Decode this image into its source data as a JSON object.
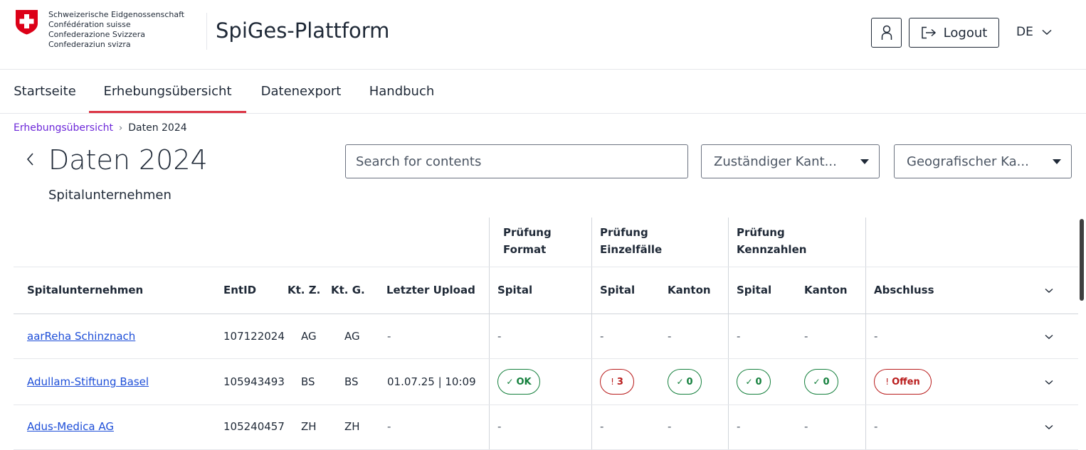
{
  "header": {
    "confederation": [
      "Schweizerische Eidgenossenschaft",
      "Confédération suisse",
      "Confederazione Svizzera",
      "Confederaziun svizra"
    ],
    "app_title": "SpiGes-Plattform",
    "logout_label": "Logout",
    "language": "DE"
  },
  "nav": {
    "items": [
      {
        "label": "Startseite"
      },
      {
        "label": "Erhebungsübersicht",
        "active": true
      },
      {
        "label": "Datenexport"
      },
      {
        "label": "Handbuch"
      }
    ]
  },
  "breadcrumb": {
    "parent": "Erhebungsübersicht",
    "separator": "›",
    "current": "Daten 2024"
  },
  "page": {
    "title": "Daten 2024",
    "subtitle": "Spitalunternehmen"
  },
  "filters": {
    "search_placeholder": "Search for contents",
    "canton_responsible": "Zuständiger Kant...",
    "canton_geographic": "Geografischer Ka..."
  },
  "table": {
    "group_headers": {
      "format": [
        "Prüfung",
        "Format"
      ],
      "einzelfaelle": [
        "Prüfung",
        "Einzelfälle"
      ],
      "kennzahlen": [
        "Prüfung",
        "Kennzahlen"
      ]
    },
    "columns": {
      "name": "Spitalunternehmen",
      "entid": "EntID",
      "ktz": "Kt. Z.",
      "ktg": "Kt. G.",
      "upload": "Letzter Upload",
      "format_spital": "Spital",
      "einzel_spital": "Spital",
      "einzel_kanton": "Kanton",
      "kenn_spital": "Spital",
      "kenn_kanton": "Kanton",
      "abschluss": "Abschluss"
    },
    "rows": [
      {
        "name": "aarReha Schinznach",
        "entid": "107122024",
        "ktz": "AG",
        "ktg": "AG",
        "upload": "-",
        "format_spital": "-",
        "einzel_spital": "-",
        "einzel_kanton": "-",
        "kenn_spital": "-",
        "kenn_kanton": "-",
        "abschluss": "-"
      },
      {
        "name": "Adullam-Stiftung Basel",
        "entid": "105943493",
        "ktz": "BS",
        "ktg": "BS",
        "upload": "01.07.25 | 10:09",
        "format_spital": "OK",
        "einzel_spital": "3",
        "einzel_kanton": "0",
        "kenn_spital": "0",
        "kenn_kanton": "0",
        "abschluss": "Offen"
      },
      {
        "name": "Adus-Medica AG",
        "entid": "105240457",
        "ktz": "ZH",
        "ktg": "ZH",
        "upload": "-",
        "format_spital": "-",
        "einzel_spital": "-",
        "einzel_kanton": "-",
        "kenn_spital": "-",
        "kenn_kanton": "-",
        "abschluss": "-"
      }
    ]
  },
  "status_symbols": {
    "ok": "✓",
    "warn": "!"
  },
  "colors": {
    "accent_red": "#dc3545",
    "link_blue": "#1d4ed8",
    "ok_green": "#15803d",
    "error_red": "#b91c1c",
    "breadcrumb_purple": "#6d28d9"
  },
  "icons": [
    "swiss-cross-logo",
    "user-icon",
    "logout-icon",
    "chevron-down-icon",
    "back-chevron-icon",
    "dropdown-caret-icon"
  ]
}
